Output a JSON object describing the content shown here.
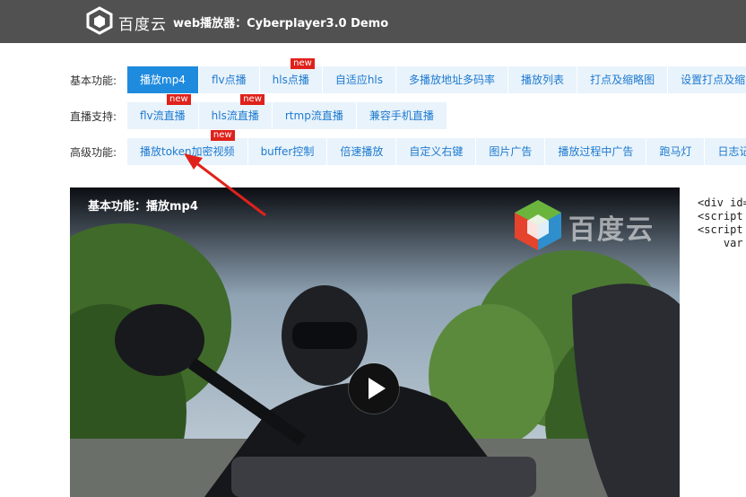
{
  "header": {
    "logo_text": "百度云",
    "title": "web播放器：Cyberplayer3.0 Demo"
  },
  "rows": [
    {
      "label": "基本功能:",
      "tabs": [
        {
          "label": "播放mp4",
          "active": true,
          "new": false
        },
        {
          "label": "flv点播",
          "active": false,
          "new": false
        },
        {
          "label": "hls点播",
          "active": false,
          "new": true
        },
        {
          "label": "自适应hls",
          "active": false,
          "new": false
        },
        {
          "label": "多播放地址多码率",
          "active": false,
          "new": false
        },
        {
          "label": "播放列表",
          "active": false,
          "new": false
        },
        {
          "label": "打点及缩略图",
          "active": false,
          "new": false
        },
        {
          "label": "设置打点及缩",
          "active": false,
          "new": false
        }
      ]
    },
    {
      "label": "直播支持:",
      "tabs": [
        {
          "label": "flv流直播",
          "active": false,
          "new": true
        },
        {
          "label": "hls流直播",
          "active": false,
          "new": true
        },
        {
          "label": "rtmp流直播",
          "active": false,
          "new": false
        },
        {
          "label": "兼容手机直播",
          "active": false,
          "new": false
        }
      ]
    },
    {
      "label": "高级功能:",
      "tabs": [
        {
          "label": "播放token加密视频",
          "active": false,
          "new": true
        },
        {
          "label": "buffer控制",
          "active": false,
          "new": false
        },
        {
          "label": "倍速播放",
          "active": false,
          "new": false
        },
        {
          "label": "自定义右键",
          "active": false,
          "new": false
        },
        {
          "label": "图片广告",
          "active": false,
          "new": false
        },
        {
          "label": "播放过程中广告",
          "active": false,
          "new": false
        },
        {
          "label": "跑马灯",
          "active": false,
          "new": false
        },
        {
          "label": "日志记录",
          "active": false,
          "new": false
        }
      ]
    }
  ],
  "badge_text": "new",
  "video": {
    "title": "基本功能：播放mp4",
    "watermark_text": "百度云"
  },
  "code_lines": [
    "<div id=",
    "<script ",
    "<script ",
    "    var "
  ],
  "colors": {
    "header_bg": "#515151",
    "tab_bg": "#e9f3fb",
    "tab_text": "#1d7ad0",
    "tab_active_bg": "#1f8bdf",
    "badge_bg": "#e0211b",
    "annotation_arrow": "#e0211b"
  }
}
